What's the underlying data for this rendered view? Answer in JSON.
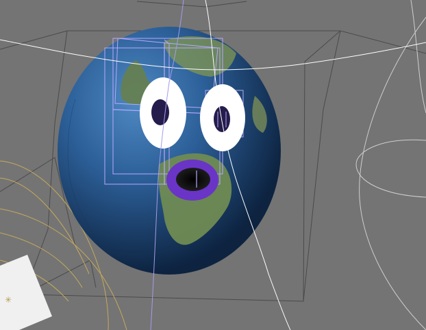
{
  "viewport": {
    "label": ""
  },
  "scene": {
    "globe": {
      "ocean_color": "#2b5d93",
      "land_color": "#6d8a5a",
      "shadow_color": "#0d2340"
    },
    "eyes": {
      "sclera_color": "#ffffff",
      "pupil_color": "#241d4b"
    },
    "mouth": {
      "lip_color": "#6a34c7",
      "inner_color": "#111111"
    },
    "rig_color": "#b8a8ff",
    "wireframe_color": "#3f3f3f",
    "curve_color": "#ffffff",
    "light_color": "#c5aa5c",
    "card_color": "#f0f0f0"
  }
}
